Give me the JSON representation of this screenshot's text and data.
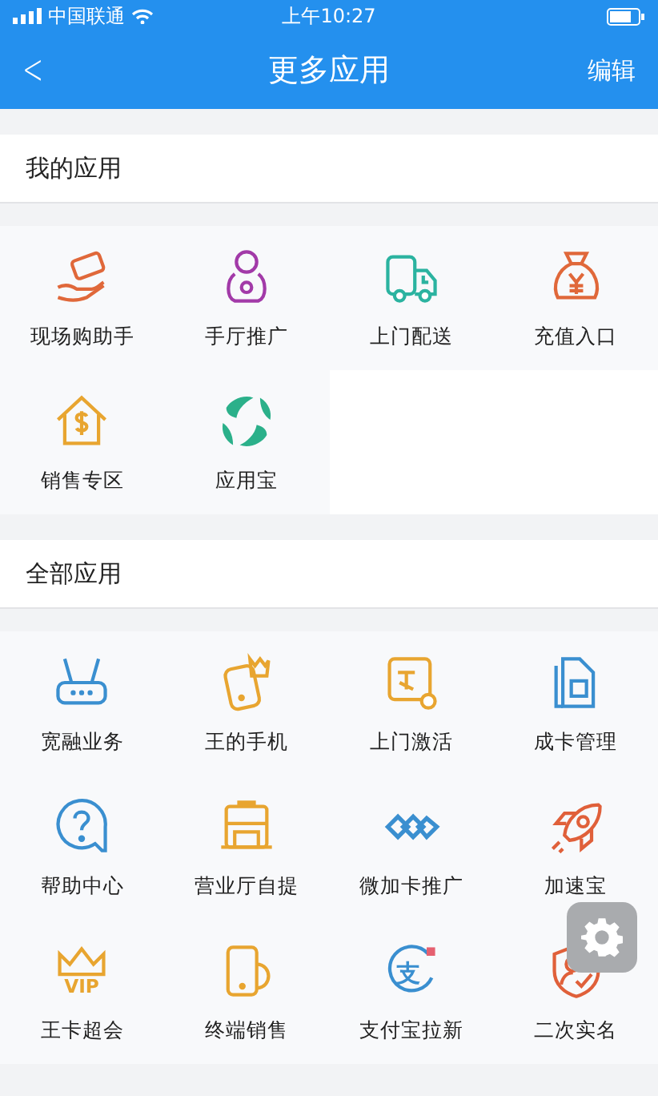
{
  "status_bar": {
    "carrier": "中国联通",
    "time": "上午10:27"
  },
  "nav": {
    "back": "<",
    "title": "更多应用",
    "action": "编辑"
  },
  "sections": [
    {
      "title": "我的应用",
      "apps": [
        {
          "label": "现场购助手"
        },
        {
          "label": "手厅推广"
        },
        {
          "label": "上门配送"
        },
        {
          "label": "充值入口"
        },
        {
          "label": "销售专区"
        },
        {
          "label": "应用宝"
        }
      ]
    },
    {
      "title": "全部应用",
      "apps": [
        {
          "label": "宽融业务"
        },
        {
          "label": "王的手机"
        },
        {
          "label": "上门激活"
        },
        {
          "label": "成卡管理"
        },
        {
          "label": "帮助中心"
        },
        {
          "label": "营业厅自提"
        },
        {
          "label": "微加卡推广"
        },
        {
          "label": "加速宝"
        },
        {
          "label": "王卡超会",
          "icon_text": "VIP"
        },
        {
          "label": "终端销售"
        },
        {
          "label": "支付宝拉新",
          "icon_text": "支"
        },
        {
          "label": "二次实名"
        }
      ]
    }
  ]
}
